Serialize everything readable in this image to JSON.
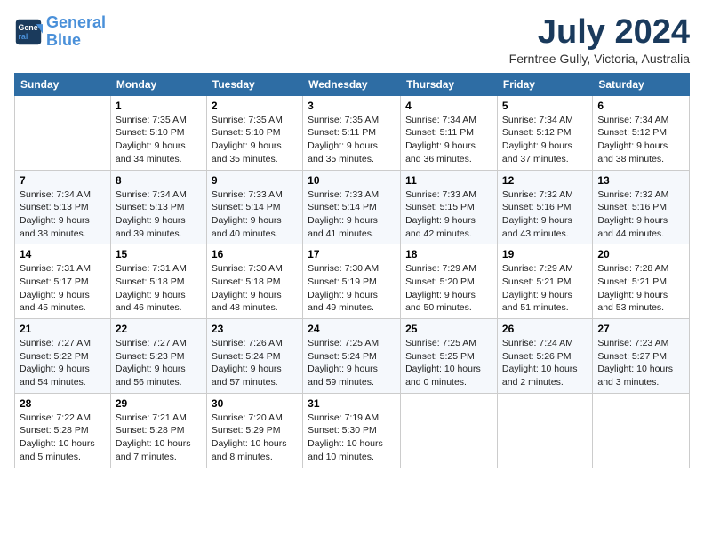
{
  "header": {
    "logo_line1": "General",
    "logo_line2": "Blue",
    "month_year": "July 2024",
    "location": "Ferntree Gully, Victoria, Australia"
  },
  "days_of_week": [
    "Sunday",
    "Monday",
    "Tuesday",
    "Wednesday",
    "Thursday",
    "Friday",
    "Saturday"
  ],
  "weeks": [
    [
      {
        "day": "",
        "content": ""
      },
      {
        "day": "1",
        "content": "Sunrise: 7:35 AM\nSunset: 5:10 PM\nDaylight: 9 hours\nand 34 minutes."
      },
      {
        "day": "2",
        "content": "Sunrise: 7:35 AM\nSunset: 5:10 PM\nDaylight: 9 hours\nand 35 minutes."
      },
      {
        "day": "3",
        "content": "Sunrise: 7:35 AM\nSunset: 5:11 PM\nDaylight: 9 hours\nand 35 minutes."
      },
      {
        "day": "4",
        "content": "Sunrise: 7:34 AM\nSunset: 5:11 PM\nDaylight: 9 hours\nand 36 minutes."
      },
      {
        "day": "5",
        "content": "Sunrise: 7:34 AM\nSunset: 5:12 PM\nDaylight: 9 hours\nand 37 minutes."
      },
      {
        "day": "6",
        "content": "Sunrise: 7:34 AM\nSunset: 5:12 PM\nDaylight: 9 hours\nand 38 minutes."
      }
    ],
    [
      {
        "day": "7",
        "content": "Sunrise: 7:34 AM\nSunset: 5:13 PM\nDaylight: 9 hours\nand 38 minutes."
      },
      {
        "day": "8",
        "content": "Sunrise: 7:34 AM\nSunset: 5:13 PM\nDaylight: 9 hours\nand 39 minutes."
      },
      {
        "day": "9",
        "content": "Sunrise: 7:33 AM\nSunset: 5:14 PM\nDaylight: 9 hours\nand 40 minutes."
      },
      {
        "day": "10",
        "content": "Sunrise: 7:33 AM\nSunset: 5:14 PM\nDaylight: 9 hours\nand 41 minutes."
      },
      {
        "day": "11",
        "content": "Sunrise: 7:33 AM\nSunset: 5:15 PM\nDaylight: 9 hours\nand 42 minutes."
      },
      {
        "day": "12",
        "content": "Sunrise: 7:32 AM\nSunset: 5:16 PM\nDaylight: 9 hours\nand 43 minutes."
      },
      {
        "day": "13",
        "content": "Sunrise: 7:32 AM\nSunset: 5:16 PM\nDaylight: 9 hours\nand 44 minutes."
      }
    ],
    [
      {
        "day": "14",
        "content": "Sunrise: 7:31 AM\nSunset: 5:17 PM\nDaylight: 9 hours\nand 45 minutes."
      },
      {
        "day": "15",
        "content": "Sunrise: 7:31 AM\nSunset: 5:18 PM\nDaylight: 9 hours\nand 46 minutes."
      },
      {
        "day": "16",
        "content": "Sunrise: 7:30 AM\nSunset: 5:18 PM\nDaylight: 9 hours\nand 48 minutes."
      },
      {
        "day": "17",
        "content": "Sunrise: 7:30 AM\nSunset: 5:19 PM\nDaylight: 9 hours\nand 49 minutes."
      },
      {
        "day": "18",
        "content": "Sunrise: 7:29 AM\nSunset: 5:20 PM\nDaylight: 9 hours\nand 50 minutes."
      },
      {
        "day": "19",
        "content": "Sunrise: 7:29 AM\nSunset: 5:21 PM\nDaylight: 9 hours\nand 51 minutes."
      },
      {
        "day": "20",
        "content": "Sunrise: 7:28 AM\nSunset: 5:21 PM\nDaylight: 9 hours\nand 53 minutes."
      }
    ],
    [
      {
        "day": "21",
        "content": "Sunrise: 7:27 AM\nSunset: 5:22 PM\nDaylight: 9 hours\nand 54 minutes."
      },
      {
        "day": "22",
        "content": "Sunrise: 7:27 AM\nSunset: 5:23 PM\nDaylight: 9 hours\nand 56 minutes."
      },
      {
        "day": "23",
        "content": "Sunrise: 7:26 AM\nSunset: 5:24 PM\nDaylight: 9 hours\nand 57 minutes."
      },
      {
        "day": "24",
        "content": "Sunrise: 7:25 AM\nSunset: 5:24 PM\nDaylight: 9 hours\nand 59 minutes."
      },
      {
        "day": "25",
        "content": "Sunrise: 7:25 AM\nSunset: 5:25 PM\nDaylight: 10 hours\nand 0 minutes."
      },
      {
        "day": "26",
        "content": "Sunrise: 7:24 AM\nSunset: 5:26 PM\nDaylight: 10 hours\nand 2 minutes."
      },
      {
        "day": "27",
        "content": "Sunrise: 7:23 AM\nSunset: 5:27 PM\nDaylight: 10 hours\nand 3 minutes."
      }
    ],
    [
      {
        "day": "28",
        "content": "Sunrise: 7:22 AM\nSunset: 5:28 PM\nDaylight: 10 hours\nand 5 minutes."
      },
      {
        "day": "29",
        "content": "Sunrise: 7:21 AM\nSunset: 5:28 PM\nDaylight: 10 hours\nand 7 minutes."
      },
      {
        "day": "30",
        "content": "Sunrise: 7:20 AM\nSunset: 5:29 PM\nDaylight: 10 hours\nand 8 minutes."
      },
      {
        "day": "31",
        "content": "Sunrise: 7:19 AM\nSunset: 5:30 PM\nDaylight: 10 hours\nand 10 minutes."
      },
      {
        "day": "",
        "content": ""
      },
      {
        "day": "",
        "content": ""
      },
      {
        "day": "",
        "content": ""
      }
    ]
  ]
}
